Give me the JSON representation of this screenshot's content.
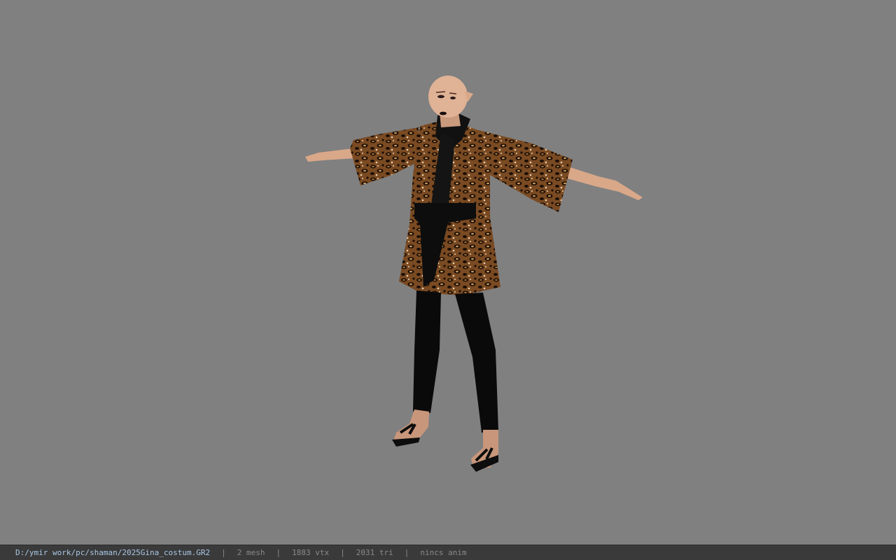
{
  "viewport": {
    "background_color": "#808080",
    "model_description": "3D character model in T-pose wearing a leopard-print kimono jacket with black sash, black leggings and black flip-flops"
  },
  "status_bar": {
    "file_path": "D:/ymir work/pc/shaman/2025Gina_costum.GR2",
    "separator": "|",
    "mesh_count": "2 mesh",
    "vertex_count": "1883 vtx",
    "triangle_count": "2031 tri",
    "anim_status": "nincs anim"
  }
}
